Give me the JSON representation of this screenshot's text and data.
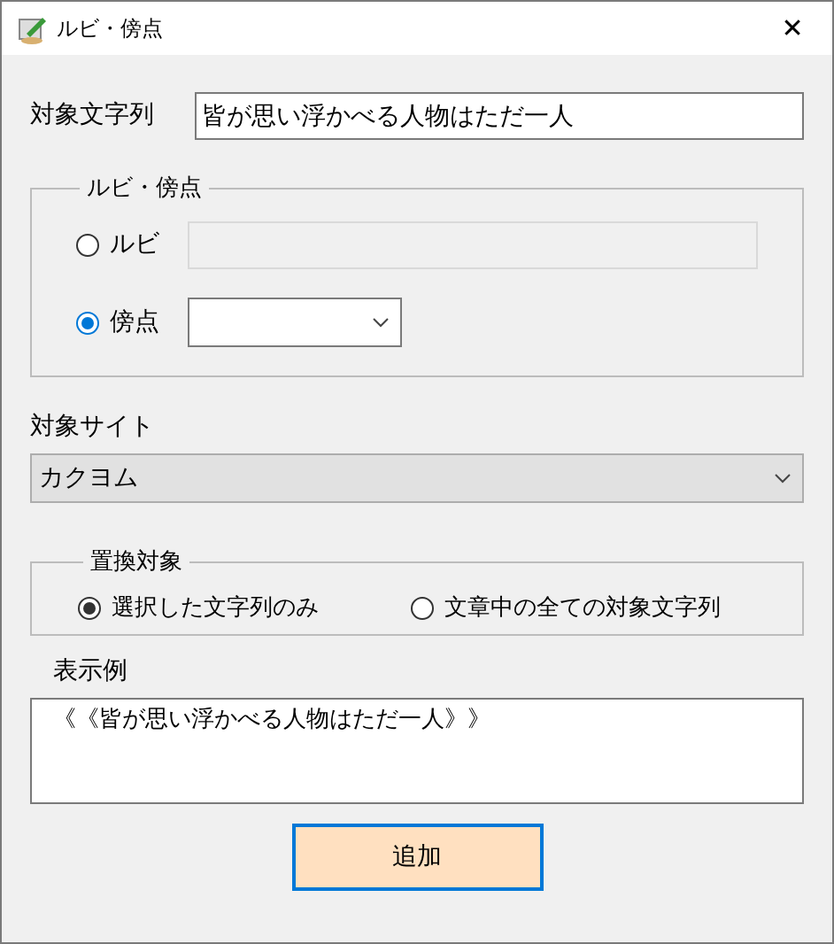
{
  "window": {
    "title": "ルビ・傍点",
    "close": "✕"
  },
  "target_string": {
    "label": "対象文字列",
    "value": "皆が思い浮かべる人物はただ一人"
  },
  "ruby_group": {
    "legend": "ルビ・傍点",
    "options": [
      {
        "kind": "text",
        "label": "ルビ",
        "selected": false,
        "disabled": true
      },
      {
        "kind": "select",
        "label": "傍点",
        "selected": true
      }
    ]
  },
  "site": {
    "label": "対象サイト",
    "value": "カクヨム"
  },
  "replace_group": {
    "legend": "置換対象",
    "options": [
      {
        "label": "選択した文字列のみ",
        "selected": true
      },
      {
        "label": "文章中の全ての対象文字列",
        "selected": false
      }
    ]
  },
  "preview": {
    "label": "表示例",
    "value": "《《皆が思い浮かべる人物はただ一人》》"
  },
  "add_button": {
    "label": "追加"
  }
}
